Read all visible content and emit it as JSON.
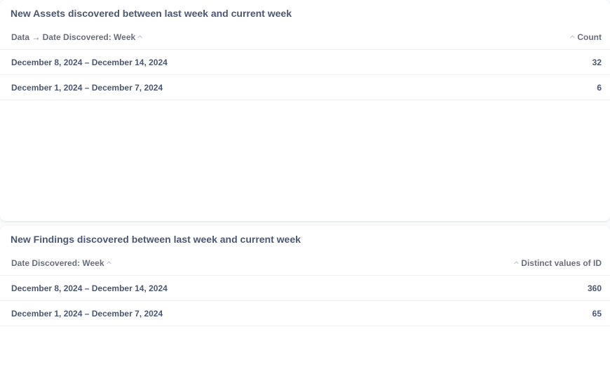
{
  "cards": [
    {
      "title": "New Assets discovered between last week and current week",
      "columns": {
        "left": "Data → Date Discovered: Week",
        "right": "Count"
      },
      "rows": [
        {
          "week": "December 8, 2024 – December 14, 2024",
          "value": "32"
        },
        {
          "week": "December 1, 2024 – December 7, 2024",
          "value": "6"
        }
      ]
    },
    {
      "title": "New Findings discovered between last week and current week",
      "columns": {
        "left": "Date Discovered: Week",
        "right": "Distinct values of ID"
      },
      "rows": [
        {
          "week": "December 8, 2024 – December 14, 2024",
          "value": "360"
        },
        {
          "week": "December 1, 2024 – December 7, 2024",
          "value": "65"
        }
      ]
    }
  ],
  "icons": {
    "sort": "chevron-up-icon"
  },
  "colors": {
    "text": "#4c5773",
    "header_text": "#696e7b",
    "icon": "#c4c8d0"
  }
}
